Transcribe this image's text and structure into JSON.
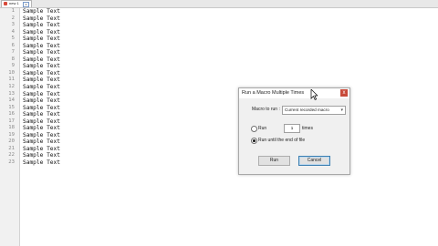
{
  "tab": {
    "label": "new 1"
  },
  "editor": {
    "lines": [
      {
        "n": "1",
        "text": "Sample Text"
      },
      {
        "n": "2",
        "text": "Sample Text"
      },
      {
        "n": "3",
        "text": "Sample Text"
      },
      {
        "n": "4",
        "text": "Sample Text"
      },
      {
        "n": "5",
        "text": "Sample Text"
      },
      {
        "n": "6",
        "text": "Sample Text"
      },
      {
        "n": "7",
        "text": "Sample Text"
      },
      {
        "n": "8",
        "text": "Sample Text"
      },
      {
        "n": "9",
        "text": "Sample Text"
      },
      {
        "n": "10",
        "text": "Sample Text"
      },
      {
        "n": "11",
        "text": "Sample Text"
      },
      {
        "n": "12",
        "text": "Sample Text"
      },
      {
        "n": "13",
        "text": "Sample Text"
      },
      {
        "n": "14",
        "text": "Sample Text"
      },
      {
        "n": "15",
        "text": "Sample Text"
      },
      {
        "n": "16",
        "text": "Sample Text"
      },
      {
        "n": "17",
        "text": "Sample Text"
      },
      {
        "n": "18",
        "text": "Sample Text"
      },
      {
        "n": "19",
        "text": "Sample Text"
      },
      {
        "n": "20",
        "text": "Sample Text"
      },
      {
        "n": "21",
        "text": "Sample Text"
      },
      {
        "n": "22",
        "text": "Sample Text"
      },
      {
        "n": "23",
        "text": "Sample Text"
      }
    ]
  },
  "dialog": {
    "title": "Run a Macro Multiple Times",
    "close_label": "x",
    "macro_label": "Macro to run :",
    "macro_value": "Current recorded macro",
    "run_label": "Run",
    "times_value": "1",
    "times_label": "times",
    "run_until_label": "Run until the end of file",
    "run_button": "Run",
    "cancel_button": "Cancel"
  },
  "colors": {
    "close_button": "#c84a3a",
    "default_button_border": "#3c7fb1"
  }
}
